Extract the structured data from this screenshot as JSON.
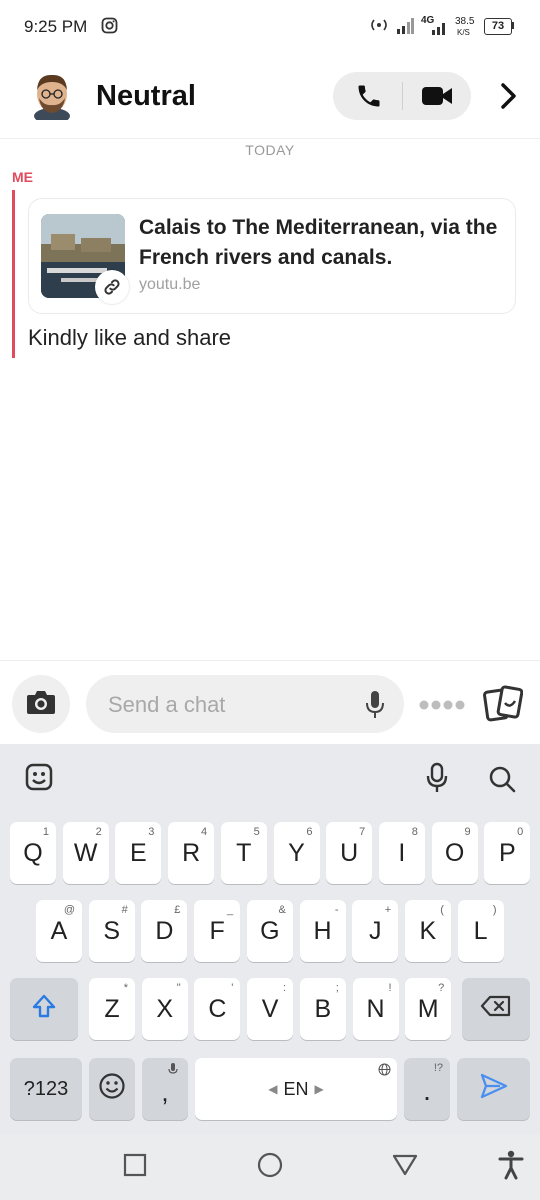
{
  "status_bar": {
    "time": "9:25 PM",
    "network": "4G",
    "speed_value": "38.5",
    "speed_unit": "K/S",
    "battery": "73"
  },
  "header": {
    "contact_name": "Neutral"
  },
  "chat": {
    "date_divider": "TODAY",
    "sender_label": "ME",
    "link_card": {
      "title": "Calais to The Mediterranean, via the French rivers and canals.",
      "domain": "youtu.be"
    },
    "message_text": "Kindly like and share"
  },
  "composer": {
    "placeholder": "Send a chat"
  },
  "keyboard": {
    "row1": [
      {
        "label": "Q",
        "hint": "1"
      },
      {
        "label": "W",
        "hint": "2"
      },
      {
        "label": "E",
        "hint": "3"
      },
      {
        "label": "R",
        "hint": "4"
      },
      {
        "label": "T",
        "hint": "5"
      },
      {
        "label": "Y",
        "hint": "6"
      },
      {
        "label": "U",
        "hint": "7"
      },
      {
        "label": "I",
        "hint": "8"
      },
      {
        "label": "O",
        "hint": "9"
      },
      {
        "label": "P",
        "hint": "0"
      }
    ],
    "row2": [
      {
        "label": "A",
        "hint": "@"
      },
      {
        "label": "S",
        "hint": "#"
      },
      {
        "label": "D",
        "hint": "£"
      },
      {
        "label": "F",
        "hint": "_"
      },
      {
        "label": "G",
        "hint": "&"
      },
      {
        "label": "H",
        "hint": "-"
      },
      {
        "label": "J",
        "hint": "+"
      },
      {
        "label": "K",
        "hint": "("
      },
      {
        "label": "L",
        "hint": ")"
      }
    ],
    "row3": [
      {
        "label": "Z",
        "hint": "*"
      },
      {
        "label": "X",
        "hint": "\""
      },
      {
        "label": "C",
        "hint": "'"
      },
      {
        "label": "V",
        "hint": ":"
      },
      {
        "label": "B",
        "hint": ";"
      },
      {
        "label": "N",
        "hint": "!"
      },
      {
        "label": "M",
        "hint": "?"
      }
    ],
    "symbols_label": "?123",
    "comma_label": ",",
    "language_label": "EN",
    "period_label": ".",
    "period_hint": "!?"
  },
  "colors": {
    "accent_red": "#e24a5d",
    "send_blue": "#4a8ff0"
  }
}
